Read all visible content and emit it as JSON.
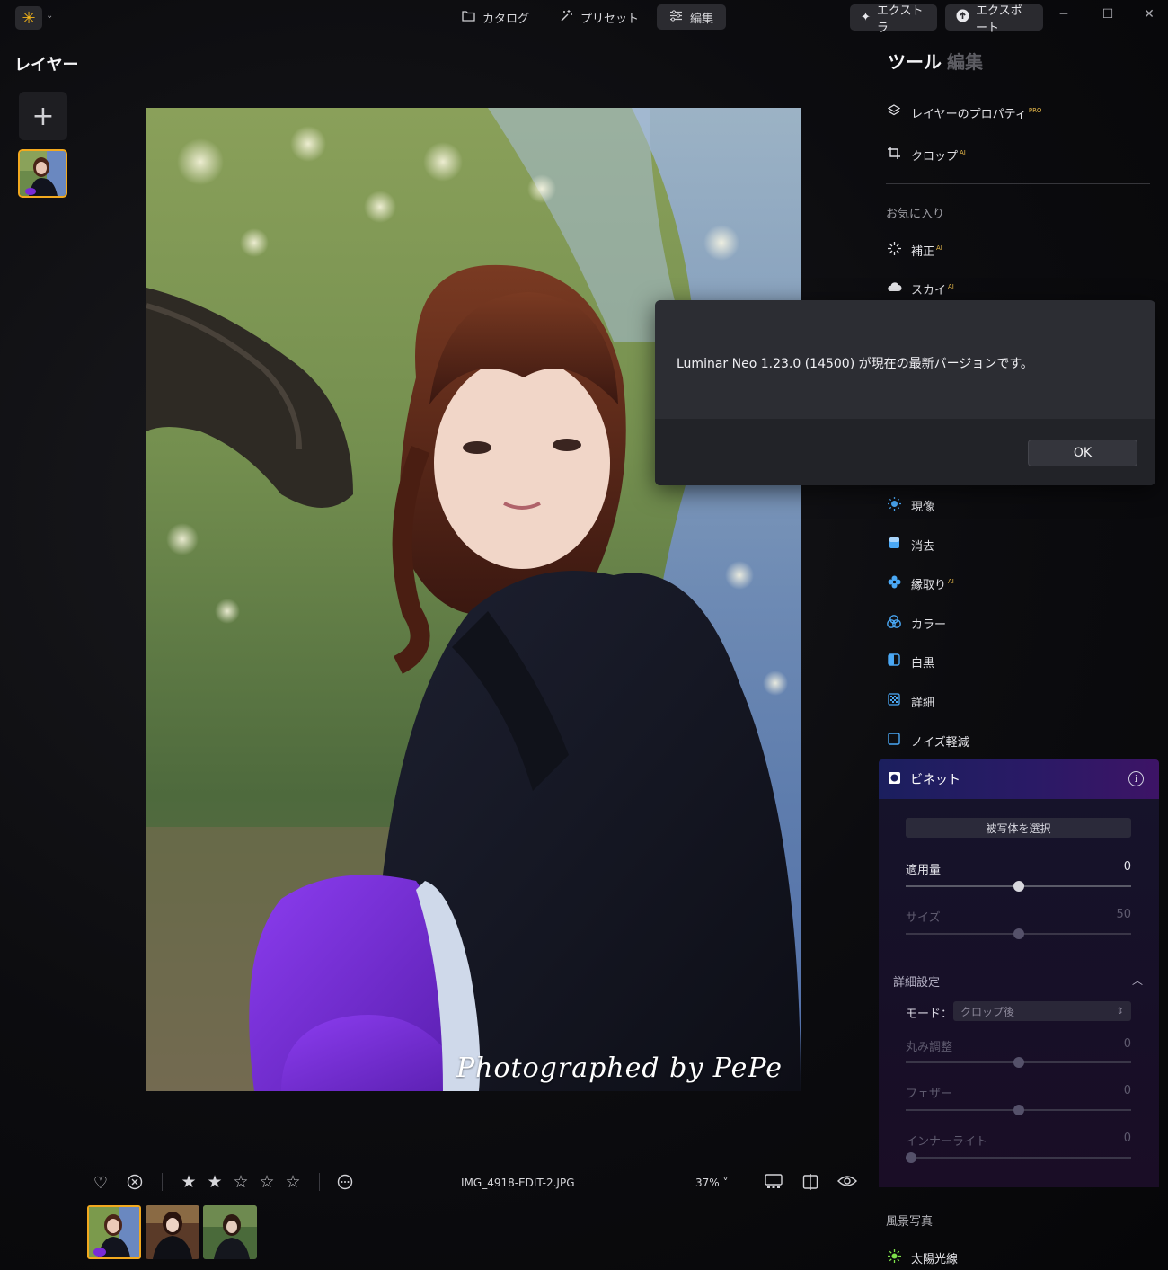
{
  "topbar": {
    "nav": [
      {
        "label": "カタログ",
        "icon": "folder-icon"
      },
      {
        "label": "プリセット",
        "icon": "sparkle-wand-icon"
      },
      {
        "label": "編集",
        "icon": "sliders-icon"
      }
    ],
    "extras_label": "エクストラ",
    "export_label": "エクスポート"
  },
  "layers": {
    "title": "レイヤー"
  },
  "photo": {
    "watermark": "Photographed by PePe"
  },
  "tools_panel": {
    "tab_tools": "ツール",
    "tab_edit": "編集",
    "items_top": [
      {
        "label": "レイヤーのプロパティ",
        "badge": "PRO",
        "icon": "layers-icon"
      },
      {
        "label": "クロップ",
        "badge": "AI",
        "icon": "crop-icon"
      }
    ],
    "favorites_label": "お気に入り",
    "favorites": [
      {
        "label": "補正",
        "badge": "AI",
        "icon": "enhance-icon"
      },
      {
        "label": "スカイ",
        "badge": "AI",
        "icon": "cloud-icon"
      }
    ],
    "items_mid": [
      {
        "label": "現像",
        "badge": "",
        "icon": "sun-icon"
      },
      {
        "label": "消去",
        "badge": "",
        "icon": "eraser-icon"
      },
      {
        "label": "縁取り",
        "badge": "AI",
        "icon": "flower-icon"
      },
      {
        "label": "カラー",
        "badge": "",
        "icon": "color-circles-icon"
      },
      {
        "label": "白黒",
        "badge": "",
        "icon": "bw-square-icon"
      },
      {
        "label": "詳細",
        "badge": "",
        "icon": "grid-detail-icon"
      },
      {
        "label": "ノイズ軽減",
        "badge": "",
        "icon": "noise-square-icon"
      }
    ],
    "vignette": {
      "title": "ビネット",
      "select_subject": "被写体を選択",
      "amount_label": "適用量",
      "amount_value": "0",
      "amount_fraction": 0.5,
      "size_label": "サイズ",
      "size_value": "50",
      "size_fraction": 0.5,
      "advanced_label": "詳細設定",
      "mode_label": "モード：",
      "mode_value": "クロップ後",
      "roundness_label": "丸み調整",
      "roundness_value": "0",
      "roundness_fraction": 0.5,
      "feather_label": "フェザー",
      "feather_value": "0",
      "feather_fraction": 0.5,
      "inner_light_label": "インナーライト",
      "inner_light_value": "0",
      "inner_light_fraction": 0.0
    },
    "landscape_label": "風景写真",
    "landscape_items": [
      {
        "label": "太陽光線",
        "icon": "sunrays-icon"
      }
    ]
  },
  "dialog": {
    "message": "Luminar Neo 1.23.0 (14500) が現在の最新バージョンです。",
    "ok_label": "OK"
  },
  "bottombar": {
    "rating": 2,
    "rating_max": 5,
    "filename": "IMG_4918-EDIT-2.JPG",
    "zoom": "37% ˅"
  },
  "colors": {
    "accent": "#f2a91f",
    "vignette_header_start": "#1b1f5e",
    "vignette_header_end": "#3d1466"
  }
}
